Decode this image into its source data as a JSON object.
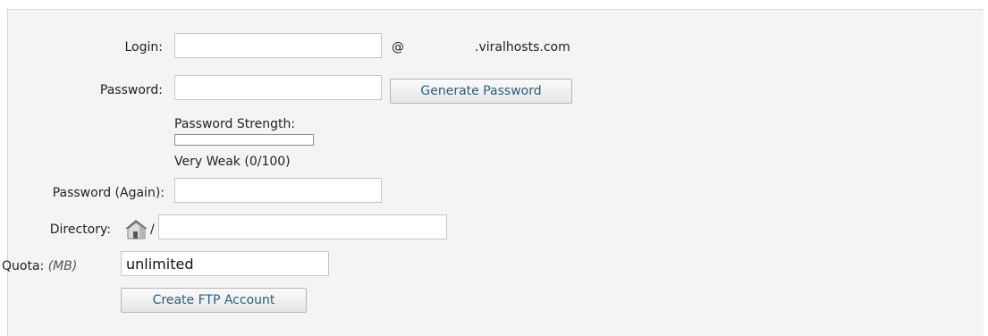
{
  "form": {
    "login_label": "Login:",
    "login_value": "",
    "at_sign": "@",
    "domain": ".viralhosts.com",
    "password_label": "Password:",
    "password_value": "",
    "generate_password_label": "Generate Password",
    "strength_label": "Password Strength:",
    "strength_text": "Very Weak (0/100)",
    "strength_score": 0,
    "strength_max": 100,
    "password_again_label": "Password (Again):",
    "password_again_value": "",
    "directory_label": "Directory:",
    "directory_slash": "/",
    "directory_value": "",
    "quota_label": "Quota:",
    "quota_unit": "(MB)",
    "quota_value": "unlimited",
    "create_button_label": "Create FTP Account"
  },
  "colors": {
    "panel_background": "#f4f4f4",
    "button_text": "#2a5f7a"
  },
  "icons": {
    "directory": "home-icon"
  }
}
